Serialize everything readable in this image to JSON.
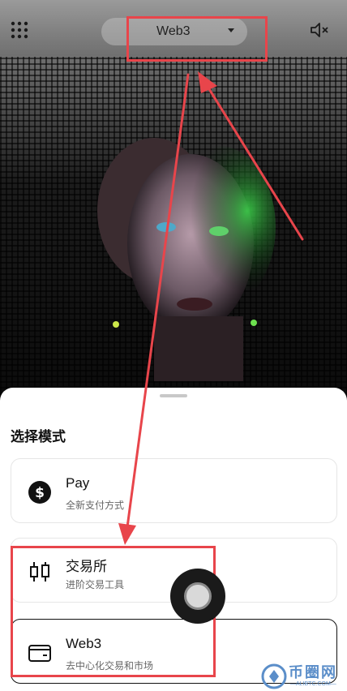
{
  "header": {
    "mode_label": "Web3",
    "menu_icon": "grid-menu-icon",
    "mute_icon": "speaker-mute-icon"
  },
  "sheet": {
    "title": "选择模式",
    "cards": [
      {
        "title": "Pay",
        "subtitle": "全新支付方式",
        "icon": "dollar-circle-icon"
      },
      {
        "title": "交易所",
        "subtitle": "进阶交易工具",
        "icon": "candlestick-icon"
      },
      {
        "title": "Web3",
        "subtitle": "去中心化交易和市场",
        "icon": "wallet-icon",
        "selected": true
      }
    ]
  },
  "annotations": {
    "highlight_color": "#e8454b"
  },
  "watermark": {
    "text": "币圈网",
    "sub": "—ALIBTC.COM—"
  }
}
